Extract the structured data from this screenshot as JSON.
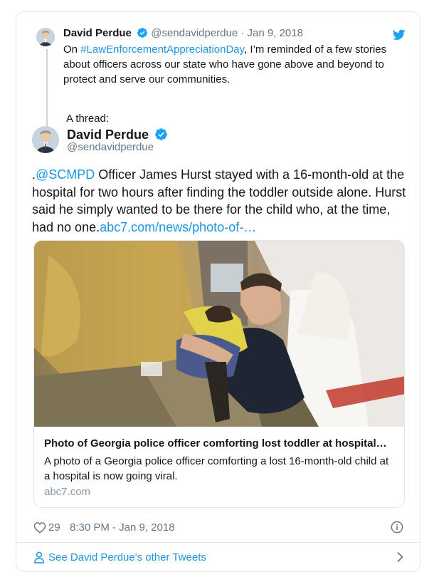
{
  "parent_tweet": {
    "author_name": "David Perdue",
    "handle": "@sendavidperdue",
    "separator": "·",
    "date": "Jan 9, 2018",
    "text_prefix": "On ",
    "hashtag": "#LawEnforcementAppreciationDay",
    "text_suffix": ", I’m reminded of a few stories about officers across our state who have gone above and beyond to protect and serve our communities.",
    "thread_label": "A thread:"
  },
  "main_tweet": {
    "author_name": "David Perdue",
    "handle": "@sendavidperdue",
    "text_prefix": ".",
    "mention": "@SCMPD",
    "text_body": " Officer James Hurst stayed with a 16-month-old at the hospital for two hours after finding the toddler outside alone. Hurst said he simply wanted to be there for the child who, at the time, had no one.",
    "link": "abc7.com/news/photo-of-…"
  },
  "link_card": {
    "title": "Photo of Georgia police officer comforting lost toddler at hospital…",
    "description": "A photo of a Georgia police officer comforting a lost 16-month-old child at a hospital is now going viral.",
    "domain": "abc7.com"
  },
  "footer": {
    "like_count": "29",
    "timestamp": "8:30 PM - Jan 9, 2018",
    "see_more_label": "See David Perdue's other Tweets"
  },
  "icons": {
    "verified": "verified-badge-icon",
    "bird": "twitter-bird-icon",
    "heart": "heart-icon",
    "info": "info-icon",
    "person": "person-icon",
    "chevron": "chevron-right-icon"
  },
  "colors": {
    "link": "#1b95e0",
    "secondary_text": "#657786",
    "border": "#e1e8ed",
    "verified": "#1da1f2"
  }
}
